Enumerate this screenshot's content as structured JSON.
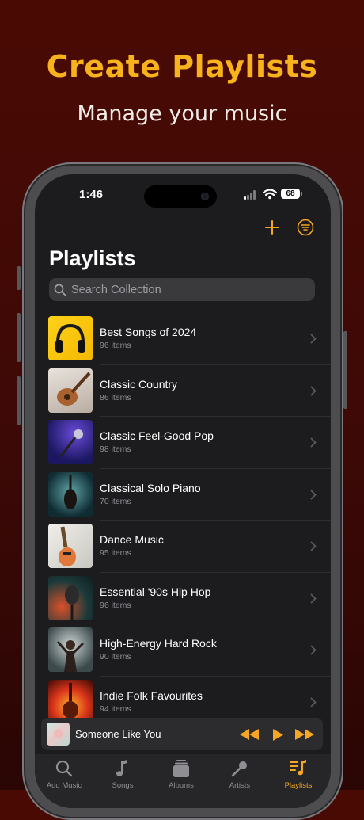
{
  "promo": {
    "headline": "Create Playlists",
    "subline": "Manage your music",
    "headline_color": "#f7b21c"
  },
  "status_bar": {
    "time": "1:46",
    "battery": "68"
  },
  "toolbar": {
    "add_icon": "plus-icon",
    "filter_icon": "filter-lines-icon"
  },
  "page": {
    "title": "Playlists"
  },
  "search": {
    "placeholder": "Search Collection"
  },
  "accent_color": "#f5a623",
  "playlists": [
    {
      "title": "Best Songs of 2024",
      "count": "96 items",
      "art": "headphones-art"
    },
    {
      "title": "Classic Country",
      "count": "86 items",
      "art": "acoustic-guitar-art"
    },
    {
      "title": "Classic Feel-Good Pop",
      "count": "98 items",
      "art": "microphone-stage-art"
    },
    {
      "title": "Classical Solo Piano",
      "count": "70 items",
      "art": "violin-art"
    },
    {
      "title": "Dance Music",
      "count": "95 items",
      "art": "electric-guitar-art"
    },
    {
      "title": "Essential '90s Hip Hop",
      "count": "96 items",
      "art": "vintage-microphone-art"
    },
    {
      "title": "High-Energy Hard Rock",
      "count": "90 items",
      "art": "rock-singer-art"
    },
    {
      "title": "Indie Folk Favourites",
      "count": "94 items",
      "art": "guitar-fire-art"
    }
  ],
  "now_playing": {
    "song": "Someone Like You",
    "controls": [
      "rewind-icon",
      "play-icon",
      "fast-forward-icon"
    ]
  },
  "tabs": [
    {
      "label": "Add Music",
      "icon": "search-icon",
      "active": false
    },
    {
      "label": "Songs",
      "icon": "music-note-icon",
      "active": false
    },
    {
      "label": "Albums",
      "icon": "album-stack-icon",
      "active": false
    },
    {
      "label": "Artists",
      "icon": "microphone-icon",
      "active": false
    },
    {
      "label": "Playlists",
      "icon": "playlist-icon",
      "active": true
    }
  ]
}
